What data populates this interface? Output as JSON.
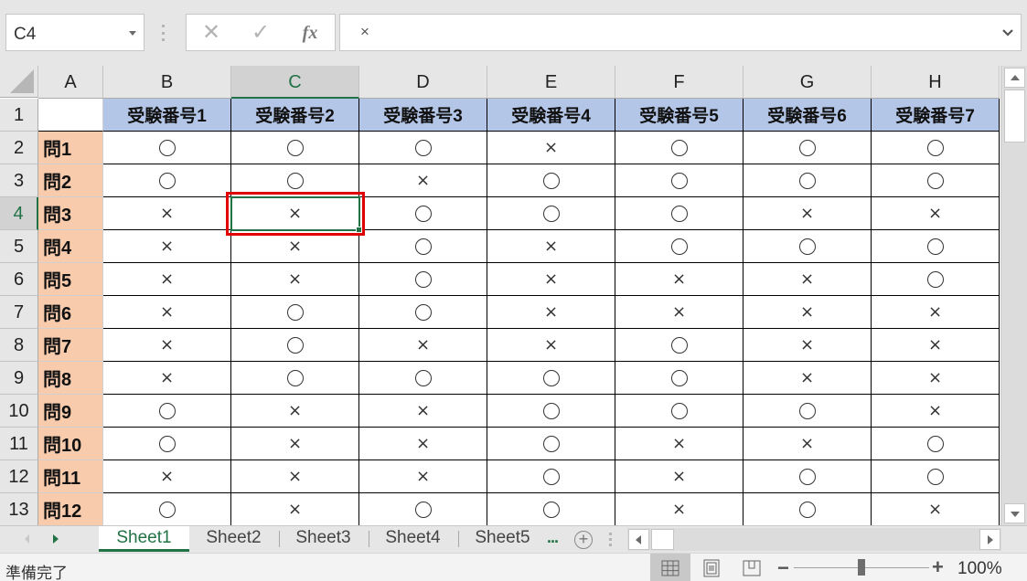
{
  "formula_bar": {
    "name_box": "C4",
    "cancel_icon": "✕",
    "enter_icon": "✓",
    "fx_label": "fx",
    "formula_value": "×"
  },
  "columns": [
    "A",
    "B",
    "C",
    "D",
    "E",
    "F",
    "G",
    "H"
  ],
  "selected_cell": {
    "column": "C",
    "row": 4
  },
  "rows": [
    1,
    2,
    3,
    4,
    5,
    6,
    7,
    8,
    9,
    10,
    11,
    12,
    13
  ],
  "header_row": [
    "",
    "受験番号1",
    "受験番号2",
    "受験番号3",
    "受験番号4",
    "受験番号5",
    "受験番号6",
    "受験番号7"
  ],
  "questions": [
    {
      "label": "問1",
      "answers": [
        "○",
        "○",
        "○",
        "×",
        "○",
        "○",
        "○"
      ]
    },
    {
      "label": "問2",
      "answers": [
        "○",
        "○",
        "×",
        "○",
        "○",
        "○",
        "○"
      ]
    },
    {
      "label": "問3",
      "answers": [
        "×",
        "×",
        "○",
        "○",
        "○",
        "×",
        "×"
      ]
    },
    {
      "label": "問4",
      "answers": [
        "×",
        "×",
        "○",
        "×",
        "○",
        "○",
        "○"
      ]
    },
    {
      "label": "問5",
      "answers": [
        "×",
        "×",
        "○",
        "×",
        "×",
        "×",
        "○"
      ]
    },
    {
      "label": "問6",
      "answers": [
        "×",
        "○",
        "○",
        "×",
        "×",
        "×",
        "×"
      ]
    },
    {
      "label": "問7",
      "answers": [
        "×",
        "○",
        "×",
        "×",
        "○",
        "×",
        "×"
      ]
    },
    {
      "label": "問8",
      "answers": [
        "×",
        "○",
        "○",
        "○",
        "○",
        "×",
        "×"
      ]
    },
    {
      "label": "問9",
      "answers": [
        "○",
        "×",
        "×",
        "○",
        "○",
        "○",
        "×"
      ]
    },
    {
      "label": "問10",
      "answers": [
        "○",
        "×",
        "×",
        "○",
        "×",
        "×",
        "○"
      ]
    },
    {
      "label": "問11",
      "answers": [
        "×",
        "×",
        "×",
        "○",
        "×",
        "○",
        "○"
      ]
    },
    {
      "label": "問12",
      "answers": [
        "○",
        "×",
        "○",
        "○",
        "×",
        "○",
        "×"
      ]
    }
  ],
  "sheet_tabs": [
    "Sheet1",
    "Sheet2",
    "Sheet3",
    "Sheet4",
    "Sheet5"
  ],
  "active_sheet": "Sheet1",
  "more_sheets": "...",
  "status_bar": {
    "status_text": "準備完了",
    "zoom_percent": "100%",
    "zoom_value": 100
  },
  "colors": {
    "accent_green": "#217346",
    "header_fill": "#b4c6e7",
    "question_fill": "#f8cbad",
    "highlight_red": "#e00000"
  }
}
